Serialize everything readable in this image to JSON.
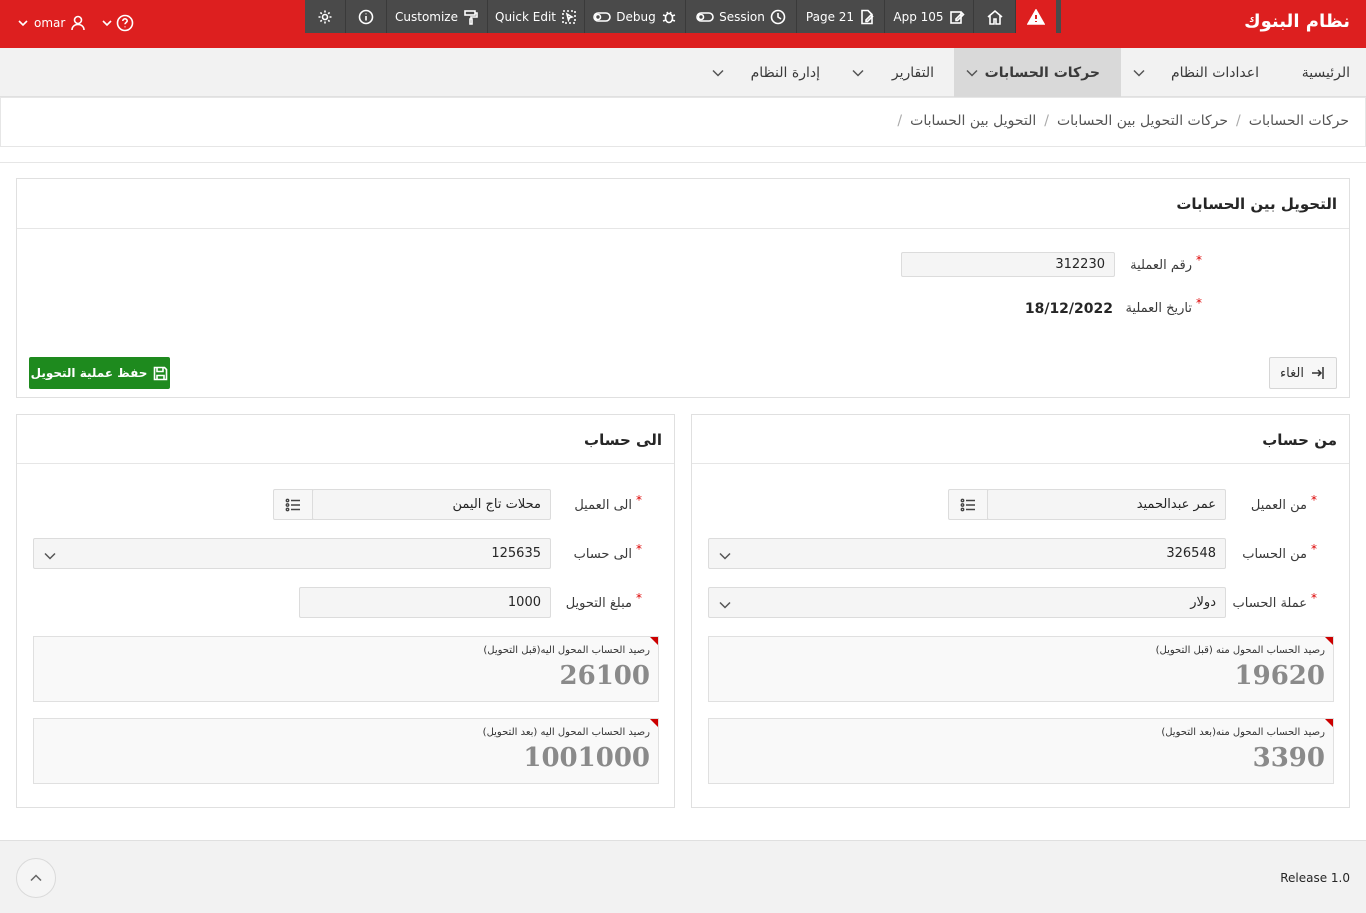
{
  "header": {
    "app_title": "نظام البنوك",
    "user_name": "omar",
    "toolbar": {
      "app": "App 105",
      "page": "Page 21",
      "session": "Session",
      "debug": "Debug",
      "quick_edit": "Quick Edit",
      "customize": "Customize"
    }
  },
  "nav": {
    "items": [
      {
        "label": "الرئيسية"
      },
      {
        "label": "اعدادات النظام"
      },
      {
        "label": "حركات الحسابات"
      },
      {
        "label": "التقارير"
      },
      {
        "label": "إدارة النظام"
      }
    ]
  },
  "breadcrumb": [
    "حركات الحسابات",
    "حركات التحويل بين الحسابات",
    "التحويل بين الحسابات"
  ],
  "main_region": {
    "title": "التحويل بين الحسابات",
    "op_number_label": "رقم العملية",
    "op_number_value": "312230",
    "op_date_label": "تاريخ العملية",
    "op_date_value": "18/12/2022",
    "save_button": "حفظ عملية التحويل",
    "cancel_button": "الغاء"
  },
  "from_region": {
    "title": "من حساب",
    "customer_label": "من العميل",
    "customer_value": "عمر عبدالحميد",
    "account_label": "من الحساب",
    "account_value": "326548",
    "currency_label": "عملة الحساب",
    "currency_value": "دولار",
    "balance_before_label": "رصيد الحساب المحول منه (قبل التحويل)",
    "balance_before_value": "19620",
    "balance_after_label": "رصيد الحساب المحول منه(بعد التحويل)",
    "balance_after_value": "3390"
  },
  "to_region": {
    "title": "الى حساب",
    "customer_label": "الى العميل",
    "customer_value": "محلات تاج اليمن",
    "account_label": "الى حساب",
    "account_value": "125635",
    "amount_label": "مبلغ التحويل",
    "amount_value": "1000",
    "balance_before_label": "رصيد الحساب المحول اليه(قبل التحويل)",
    "balance_before_value": "26100",
    "balance_after_label": "رصيد الحساب المحول اليه (بعد التحويل)",
    "balance_after_value": "1001000"
  },
  "footer": {
    "release": "Release 1.0"
  }
}
